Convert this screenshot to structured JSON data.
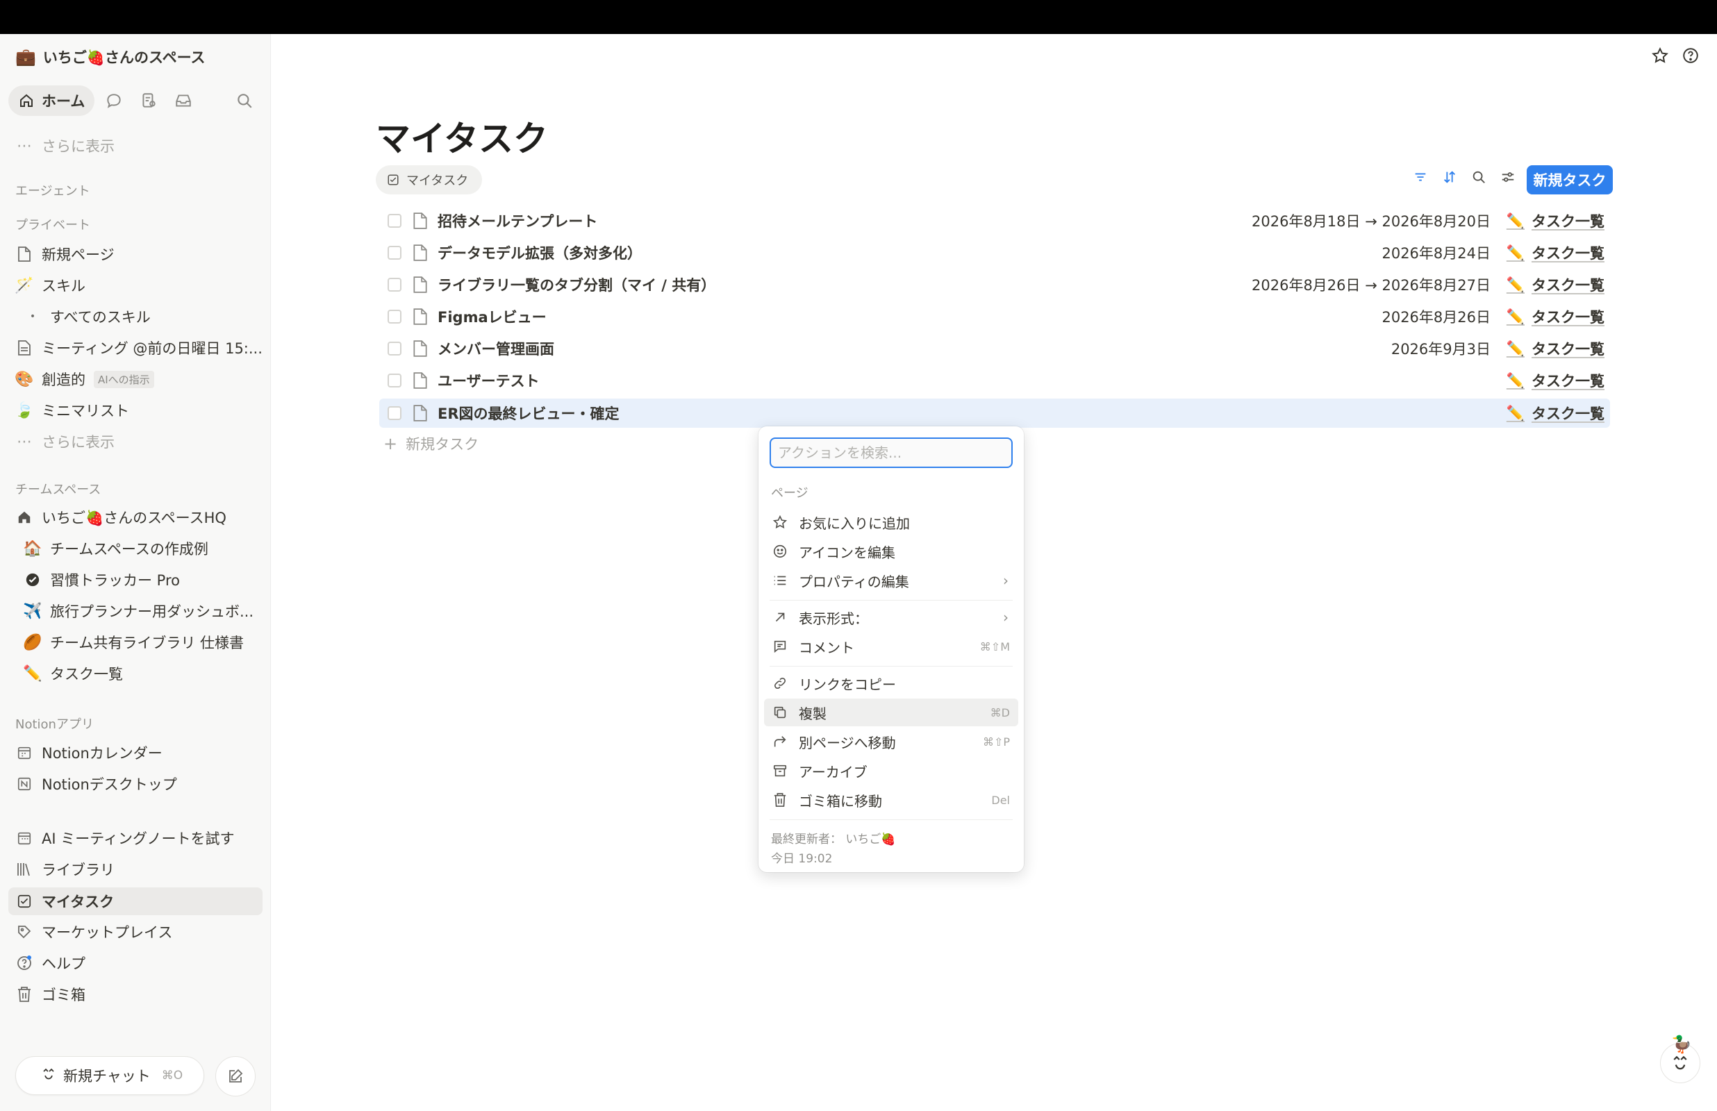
{
  "workspace": {
    "name": "いちご🍓さんのスペース"
  },
  "nav": {
    "home_label": "ホーム"
  },
  "sidebar": {
    "show_more_top": "さらに表示",
    "agent_section": "エージェント",
    "private_section": "プライベート",
    "private_items": [
      {
        "label": "新規ページ"
      },
      {
        "label": "スキル"
      },
      {
        "label": "すべてのスキル"
      },
      {
        "label": "ミーティング @前の日曜日 15:..."
      },
      {
        "label": "創造的",
        "tag": "AIへの指示"
      },
      {
        "label": "ミニマリスト"
      },
      {
        "label": "さらに表示"
      }
    ],
    "team_section": "チームスペース",
    "team_items": [
      {
        "label": "いちご🍓さんのスペースHQ"
      },
      {
        "label": "チームスペースの作成例"
      },
      {
        "label": "習慣トラッカー Pro"
      },
      {
        "label": "旅行プランナー用ダッシュボ..."
      },
      {
        "label": "チーム共有ライブラリ 仕様書"
      },
      {
        "label": "タスク一覧"
      }
    ],
    "apps_section": "Notionアプリ",
    "app_items": [
      {
        "label": "Notionカレンダー"
      },
      {
        "label": "Notionデスクトップ"
      }
    ],
    "bottom_items": [
      {
        "label": "AI ミーティングノートを試す"
      },
      {
        "label": "ライブラリ"
      },
      {
        "label": "マイタスク"
      },
      {
        "label": "マーケットプレイス"
      },
      {
        "label": "ヘルプ"
      },
      {
        "label": "ゴミ箱"
      }
    ],
    "new_chat": {
      "label": "新規チャット",
      "shortcut": "⌘O"
    }
  },
  "main": {
    "title": "マイタスク",
    "view_tab": "マイタスク",
    "new_task_button": "新規タスク",
    "add_task_label": "新規タスク",
    "tasks": [
      {
        "name": "招待メールテンプレート",
        "date": "2026年8月18日 → 2026年8月20日",
        "project": "タスク一覧"
      },
      {
        "name": "データモデル拡張（多対多化）",
        "date": "2026年8月24日",
        "project": "タスク一覧"
      },
      {
        "name": "ライブラリ一覧のタブ分割（マイ / 共有）",
        "date": "2026年8月26日 → 2026年8月27日",
        "project": "タスク一覧"
      },
      {
        "name": "Figmaレビュー",
        "date": "2026年8月26日",
        "project": "タスク一覧"
      },
      {
        "name": "メンバー管理画面",
        "date": "2026年9月3日",
        "project": "タスク一覧"
      },
      {
        "name": "ユーザーテスト",
        "date": "",
        "project": "タスク一覧"
      },
      {
        "name": "ER図の最終レビュー・確定",
        "date": "",
        "project": "タスク一覧"
      }
    ]
  },
  "context_menu": {
    "search_placeholder": "アクションを検索...",
    "section": "ページ",
    "items": [
      {
        "label": "お気に入りに追加",
        "shortcut": ""
      },
      {
        "label": "アイコンを編集",
        "shortcut": ""
      },
      {
        "label": "プロパティの編集",
        "shortcut": ""
      },
      {
        "label": "表示形式：",
        "shortcut": ""
      },
      {
        "label": "コメント",
        "shortcut": "⌘⇧M"
      },
      {
        "label": "リンクをコピー",
        "shortcut": ""
      },
      {
        "label": "複製",
        "shortcut": "⌘D"
      },
      {
        "label": "別ページへ移動",
        "shortcut": "⌘⇧P"
      },
      {
        "label": "アーカイブ",
        "shortcut": ""
      },
      {
        "label": "ゴミ箱に移動",
        "shortcut": "Del"
      }
    ],
    "last_edited_by": "最終更新者： いちご🍓",
    "last_edited_time": "今日 19:02"
  },
  "colors": {
    "accent": "#2f80ed",
    "sidebar_bg": "#f8f8f7",
    "selected_row": "#e8f0fb"
  }
}
